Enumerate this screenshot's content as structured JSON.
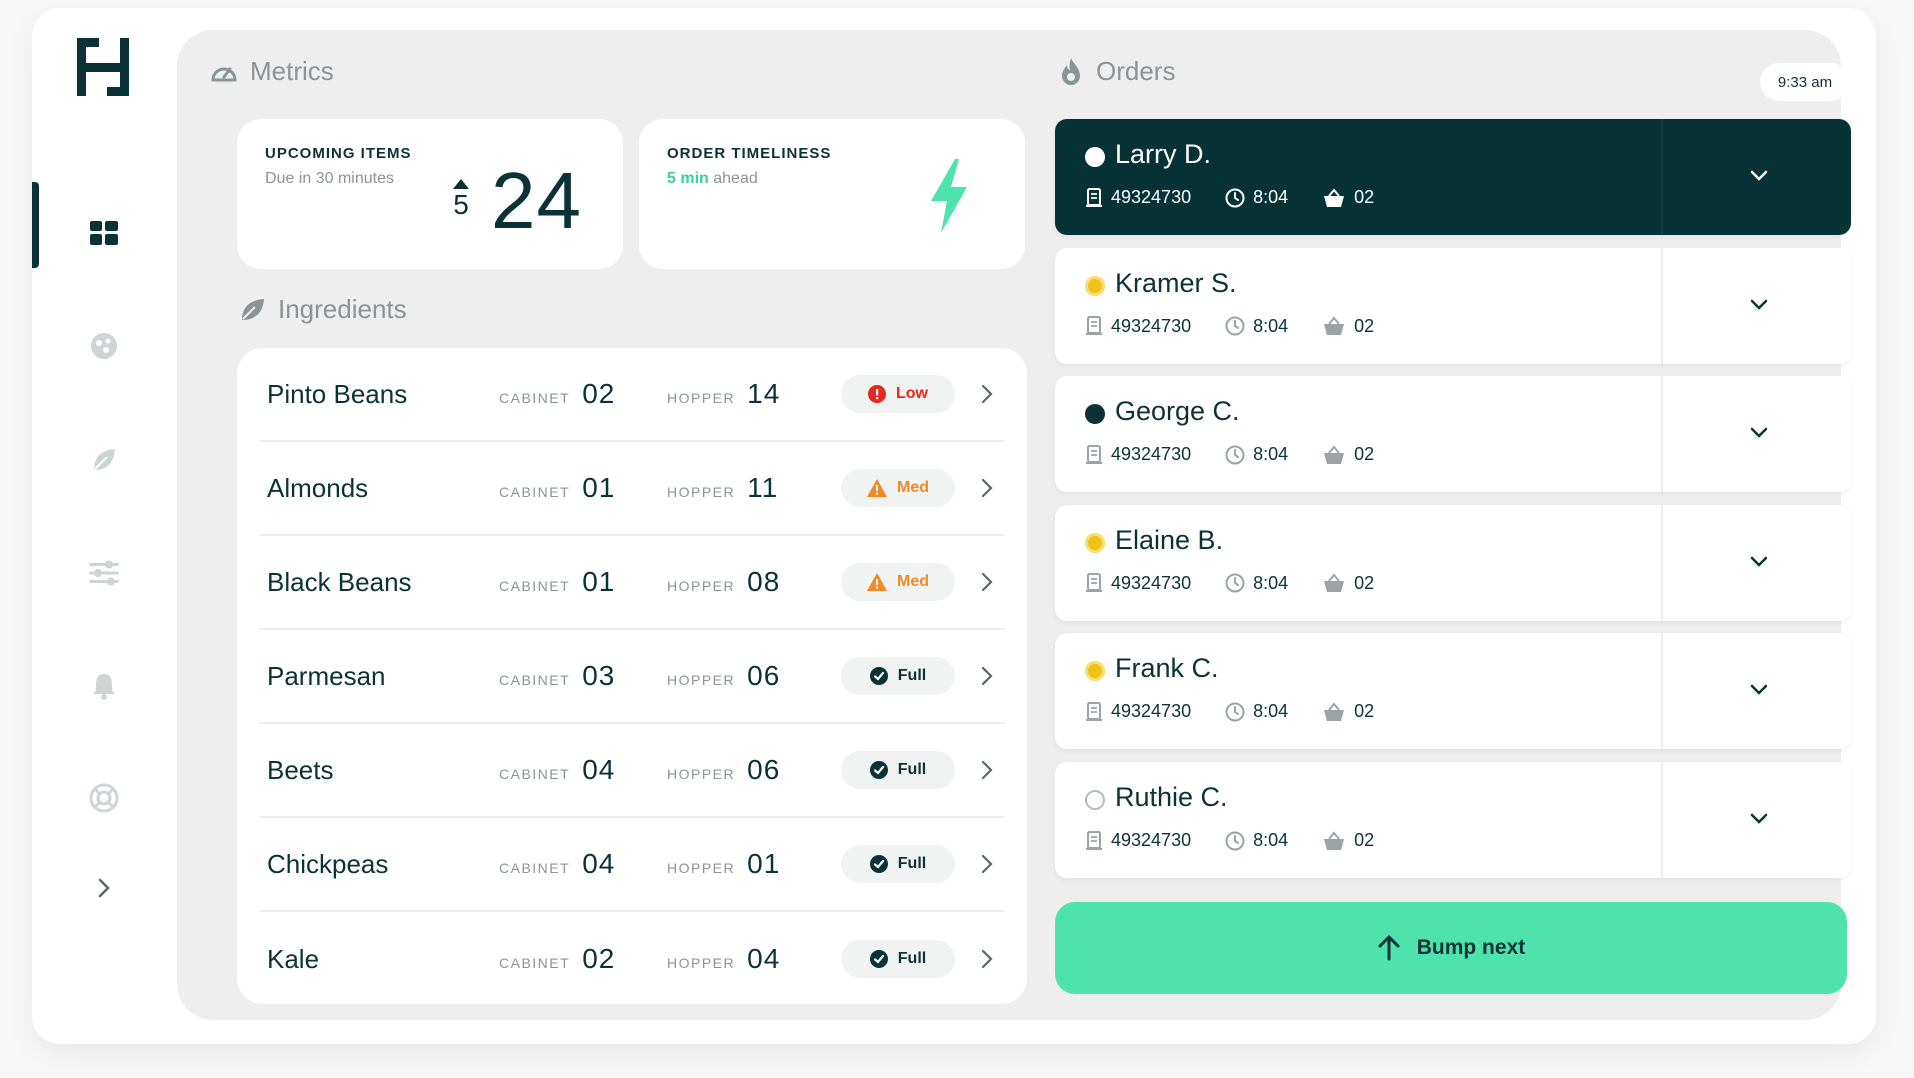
{
  "app": {
    "logo_icon": "h-logo-icon"
  },
  "sidebar": {
    "items": [
      {
        "name": "dashboard",
        "icon": "grid-icon",
        "active": true
      },
      {
        "name": "orders",
        "icon": "pizza-icon",
        "active": false
      },
      {
        "name": "ingredients",
        "icon": "leaf-icon",
        "active": false
      },
      {
        "name": "settings",
        "icon": "sliders-icon",
        "active": false
      },
      {
        "name": "alerts",
        "icon": "bell-icon",
        "active": false
      },
      {
        "name": "support",
        "icon": "lifebuoy-icon",
        "active": false
      }
    ],
    "expand_icon": "chevron-right-icon"
  },
  "metrics": {
    "title": "Metrics",
    "upcoming": {
      "label": "UPCOMING ITEMS",
      "sub": "Due in 30 minutes",
      "delta": "5",
      "value": "24"
    },
    "timeliness": {
      "label": "ORDER TIMELINESS",
      "sub_accent": "5 min",
      "sub_rest": " ahead"
    }
  },
  "ingredients": {
    "title": "Ingredients",
    "cabinet_label": "CABINET",
    "hopper_label": "HOPPER",
    "rows": [
      {
        "name": "Pinto Beans",
        "cabinet": "02",
        "hopper": "14",
        "status": "Low",
        "level": "low"
      },
      {
        "name": "Almonds",
        "cabinet": "01",
        "hopper": "11",
        "status": "Med",
        "level": "med"
      },
      {
        "name": "Black Beans",
        "cabinet": "01",
        "hopper": "08",
        "status": "Med",
        "level": "med"
      },
      {
        "name": "Parmesan",
        "cabinet": "03",
        "hopper": "06",
        "status": "Full",
        "level": "full"
      },
      {
        "name": "Beets",
        "cabinet": "04",
        "hopper": "06",
        "status": "Full",
        "level": "full"
      },
      {
        "name": "Chickpeas",
        "cabinet": "04",
        "hopper": "01",
        "status": "Full",
        "level": "full"
      },
      {
        "name": "Kale",
        "cabinet": "02",
        "hopper": "04",
        "status": "Full",
        "level": "full"
      }
    ]
  },
  "orders": {
    "title": "Orders",
    "time": "9:33 am",
    "list": [
      {
        "name": "Larry D.",
        "receipt": "49324730",
        "time": "8:04",
        "items": "02",
        "state": "ready",
        "active": true
      },
      {
        "name": "Kramer S.",
        "receipt": "49324730",
        "time": "8:04",
        "items": "02",
        "state": "in-progress",
        "active": false
      },
      {
        "name": "George C.",
        "receipt": "49324730",
        "time": "8:04",
        "items": "02",
        "state": "ready",
        "active": false
      },
      {
        "name": "Elaine B.",
        "receipt": "49324730",
        "time": "8:04",
        "items": "02",
        "state": "in-progress",
        "active": false
      },
      {
        "name": "Frank C.",
        "receipt": "49324730",
        "time": "8:04",
        "items": "02",
        "state": "in-progress",
        "active": false
      },
      {
        "name": "Ruthie C.",
        "receipt": "49324730",
        "time": "8:04",
        "items": "02",
        "state": "pending",
        "active": false
      }
    ],
    "bump_label": "Bump next"
  },
  "colors": {
    "brand_dark": "#073236",
    "accent_green": "#4ee3ac",
    "low_red": "#e5271d",
    "med_orange": "#f08a24",
    "in_progress_yellow": "#f2c118"
  }
}
